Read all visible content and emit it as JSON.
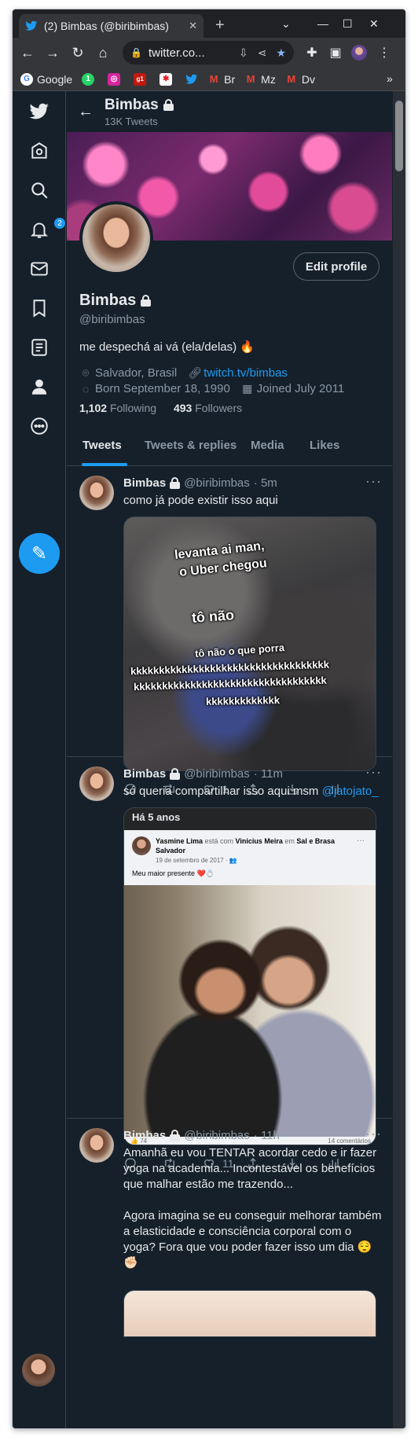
{
  "browser": {
    "tab_title": "(2) Bimbas (@biribimbas)",
    "url": "twitter.co...",
    "bookmarks": [
      {
        "label": "Google",
        "icon": "google-icon",
        "color": "#4285f4",
        "glyph": "G"
      },
      {
        "label": "",
        "icon": "whatsapp-icon",
        "color": "#25d366",
        "glyph": "1"
      },
      {
        "label": "",
        "icon": "instagram-icon",
        "color": "#d6249f",
        "glyph": "◎"
      },
      {
        "label": "",
        "icon": "g1-icon",
        "color": "#c4170c",
        "glyph": "g1"
      },
      {
        "label": "",
        "icon": "star-app-icon",
        "color": "#e01b24",
        "glyph": "✱"
      },
      {
        "label": "",
        "icon": "twitter-icon",
        "color": "#1d9bf0",
        "glyph": "t"
      },
      {
        "label": "Br",
        "icon": "gmail-icon",
        "color": "#ea4335",
        "glyph": "M"
      },
      {
        "label": "Mz",
        "icon": "gmail-icon",
        "color": "#ea4335",
        "glyph": "M"
      },
      {
        "label": "Dv",
        "icon": "gmail-icon",
        "color": "#ea4335",
        "glyph": "M"
      }
    ]
  },
  "nav": {
    "notification_count": "2"
  },
  "profile": {
    "name": "Bimbas",
    "tweet_count": "13K Tweets",
    "edit_button": "Edit profile",
    "handle": "@biribimbas",
    "bio": "me despechá ai vá (ela/delas) 🔥",
    "location": "Salvador, Brasil",
    "website": "twitch.tv/bimbas",
    "birthday": "Born September 18, 1990",
    "joined": "Joined July 2011",
    "following_count": "1,102",
    "following_label": "Following",
    "followers_count": "493",
    "followers_label": "Followers"
  },
  "tabs": [
    "Tweets",
    "Tweets & replies",
    "Media",
    "Likes"
  ],
  "tweets": [
    {
      "name": "Bimbas",
      "handle": "@biribimbas",
      "time": "· 5m",
      "text": "como já pode existir isso aqui",
      "meme": {
        "line1": "levanta ai man,",
        "line2": "o Uber chegou",
        "line3": "tô não",
        "line4": "tô não o que porra",
        "line5": "kkkkkkkkkkkkkkkkkkkkkkkkkkkkkkkkkkk",
        "line6": "kkkkkkkkkkkkkkkkkkkkkkkkkkkkkkkkkk",
        "line7": "kkkkkkkkkkkkk"
      },
      "likes": "1"
    },
    {
      "name": "Bimbas",
      "handle": "@biribimbas",
      "time": "· 11m",
      "text": "só queria compartilhar isso aqui msm ",
      "mention": "@jatojato_",
      "fb": {
        "header": "Há 5 anos",
        "author": "Yasmine Lima",
        "with": " está com ",
        "friend": "Vinicius Meira",
        "at": " em ",
        "place": "Sal e Brasa Salvador",
        "date": "19 de setembro de 2017 · 👥",
        "text": "Meu maior presente ❤️💍",
        "reactions": "74",
        "comments": "14 comentários"
      },
      "likes": "11"
    },
    {
      "name": "Bimbas",
      "handle": "@biribimbas",
      "time": "· 11h",
      "text": "Amanhã eu vou TENTAR acordar cedo e ir fazer yoga na academia... Incontestável os benefícios que malhar estão me trazendo...\n\nAgora imagina se eu conseguir melhorar também a elasticidade e consciência corporal com o yoga? Fora que vou poder fazer isso um dia 😌✊🏻"
    }
  ]
}
